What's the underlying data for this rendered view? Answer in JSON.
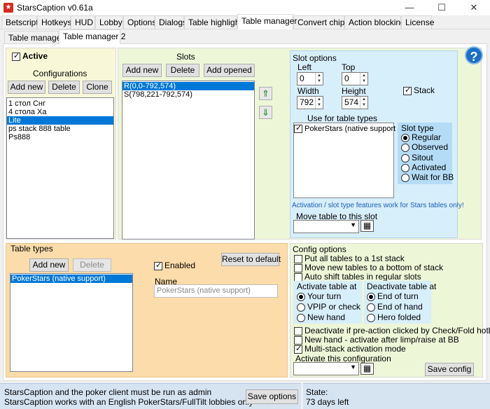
{
  "window": {
    "title": "StarsCaption v0.61a",
    "minimize": "—",
    "maximize": "☐",
    "close": "✕"
  },
  "tabs": [
    "Betscript",
    "Hotkeys",
    "HUD",
    "Lobby",
    "Options",
    "Dialogs",
    "Table highlight",
    "Table manager",
    "Convert chips",
    "Action blocking",
    "License"
  ],
  "subtabs": [
    "Table manager",
    "Table manager 2"
  ],
  "configurations": {
    "active_label": "Active",
    "active_checked": true,
    "title": "Configurations",
    "add_new": "Add new",
    "delete": "Delete",
    "clone": "Clone",
    "items": [
      "1 стол Снг",
      "4 стола Ха",
      "Lite",
      "ps stack 888 table",
      "Ps888"
    ],
    "selected_index": 2
  },
  "slots": {
    "title": "Slots",
    "add_new": "Add new",
    "delete": "Delete",
    "add_opened": "Add opened",
    "items": [
      "R(0,0-792,574)",
      "S(798,221-792,574)"
    ],
    "selected_index": 0,
    "up_arrow": "⇑",
    "down_arrow": "⇓"
  },
  "slot_options": {
    "title": "Slot options",
    "left_label": "Left",
    "left_value": "0",
    "top_label": "Top",
    "top_value": "0",
    "width_label": "Width",
    "width_value": "792",
    "height_label": "Height",
    "height_value": "574",
    "stack_label": "Stack",
    "stack_checked": true,
    "use_for_label": "Use for table types",
    "use_for_items": [
      "PokerStars (native support"
    ],
    "slot_type_title": "Slot type",
    "slot_types": [
      "Regular",
      "Observed",
      "Sitout",
      "Activated",
      "Wait for BB"
    ],
    "slot_type_selected": 0,
    "note": "Activation / slot type features work for Stars tables only!",
    "move_table_label": "Move table to this slot"
  },
  "table_types": {
    "title": "Table types",
    "add_new": "Add new",
    "delete": "Delete",
    "items": [
      "PokerStars (native support)"
    ],
    "selected_index": 0,
    "enabled_label": "Enabled",
    "enabled_checked": true,
    "reset_label": "Reset to default",
    "name_label": "Name",
    "name_value": "PokerStars (native support)"
  },
  "config_options": {
    "title": "Config options",
    "checkboxes": [
      {
        "label": "Put all tables to a 1st stack",
        "checked": false
      },
      {
        "label": "Move new tables to a bottom of stack",
        "checked": false
      },
      {
        "label": "Auto shift tables in regular slots",
        "checked": false
      }
    ],
    "activate_title": "Activate table at",
    "activate_options": [
      "Your turn",
      "VPIP or check",
      "New hand"
    ],
    "activate_selected": 0,
    "deactivate_title": "Deactivate table at",
    "deactivate_options": [
      "End of turn",
      "End of hand",
      "Hero folded"
    ],
    "deactivate_selected": 0,
    "checkboxes2": [
      {
        "label": "Deactivate if pre-action clicked by Check/Fold hotkey",
        "checked": false
      },
      {
        "label": "New hand - activate after limp/raise at BB",
        "checked": false
      },
      {
        "label": "Multi-stack activation mode",
        "checked": true
      }
    ],
    "activate_config_label": "Activate this configuration",
    "save_config": "Save config"
  },
  "status": {
    "line1": "StarsCaption and the poker client must be run as admin",
    "line2": "StarsCaption works with an English PokerStars/FullTilt lobbies only",
    "save_options": "Save options",
    "state_label": "State:",
    "state_value": "73 days left"
  }
}
